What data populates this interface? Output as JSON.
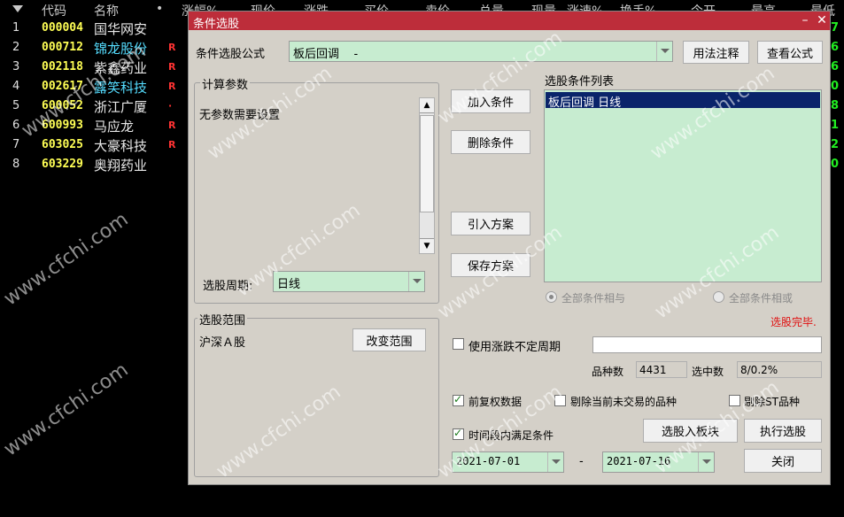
{
  "stock_list": {
    "headers": [
      "代码",
      "名称",
      "•",
      "涨幅%",
      "现价",
      "涨跌",
      "买价",
      "卖价",
      "总量",
      "现量",
      "涨速%",
      "换手%",
      "今开",
      "最高",
      "最低"
    ],
    "rows": [
      {
        "idx": "1",
        "code": "000004",
        "name": "国华网安",
        "name_color": "#e8e8e8",
        "flag": "",
        "right": "7"
      },
      {
        "idx": "2",
        "code": "000712",
        "name": "锦龙股份",
        "name_color": "#55ddff",
        "flag": "R",
        "right": "6"
      },
      {
        "idx": "3",
        "code": "002118",
        "name": "紫鑫药业",
        "name_color": "#e8e8e8",
        "flag": "R",
        "right": "6"
      },
      {
        "idx": "4",
        "code": "002617",
        "name": "露笑科技",
        "name_color": "#55ddff",
        "flag": "R",
        "right": "0"
      },
      {
        "idx": "5",
        "code": "600052",
        "name": "浙江广厦",
        "name_color": "#e8e8e8",
        "flag": "·",
        "right": "8"
      },
      {
        "idx": "6",
        "code": "600993",
        "name": "马应龙",
        "name_color": "#e8e8e8",
        "flag": "R",
        "right": "1"
      },
      {
        "idx": "7",
        "code": "603025",
        "name": "大豪科技",
        "name_color": "#e8e8e8",
        "flag": "R",
        "right": "2"
      },
      {
        "idx": "8",
        "code": "603229",
        "name": "奥翔药业",
        "name_color": "#e8e8e8",
        "flag": "",
        "right": "0"
      }
    ]
  },
  "dialog": {
    "title": "条件选股",
    "minimize_glyph": "–",
    "close_glyph": "✕",
    "formula_label": "条件选股公式",
    "formula_value": "板后回调    -",
    "usage_button": "用法注释",
    "view_formula_button": "查看公式",
    "params_group_title": "计算参数",
    "params_text": "无参数需要设置",
    "period_label": "选股周期:",
    "period_value": "日线",
    "add_condition_button": "加入条件",
    "delete_condition_button": "删除条件",
    "import_plan_button": "引入方案",
    "save_plan_button": "保存方案",
    "conditions_list_title": "选股条件列表",
    "conditions": [
      "板后回调  日线"
    ],
    "radio_and_label": "全部条件相与",
    "radio_or_label": "全部条件相或",
    "status_text": "选股完毕.",
    "range_group_title": "选股范围",
    "range_value": "沪深Ａ股",
    "change_range_button": "改变范围",
    "use_uncertain_period_label": "使用涨跌不定周期",
    "stock_count_label": "品种数",
    "stock_count_value": "4431",
    "selected_label": "选中数",
    "selected_value": "8/0.2%",
    "forward_adjust_label": "前复权数据",
    "exclude_untraded_label": "剔除当前未交易的品种",
    "exclude_st_label": "剔除ST品种",
    "time_range_label": "时间段内满足条件",
    "start_date": "2021-07-01",
    "date_sep": "-",
    "end_date": "2021-07-16",
    "select_to_block_button": "选股入板块",
    "execute_button": "执行选股",
    "close_button": "关闭"
  },
  "watermark": "www.cfchi.com",
  "colors": {
    "title_bar": "#bd2d3a",
    "dialog_bg": "#d4d0c8",
    "list_bg": "#c7ecd0",
    "selection": "#0a246a",
    "status_red": "#e01010",
    "code_yellow": "#ffff55",
    "price_green": "#22ee22"
  }
}
